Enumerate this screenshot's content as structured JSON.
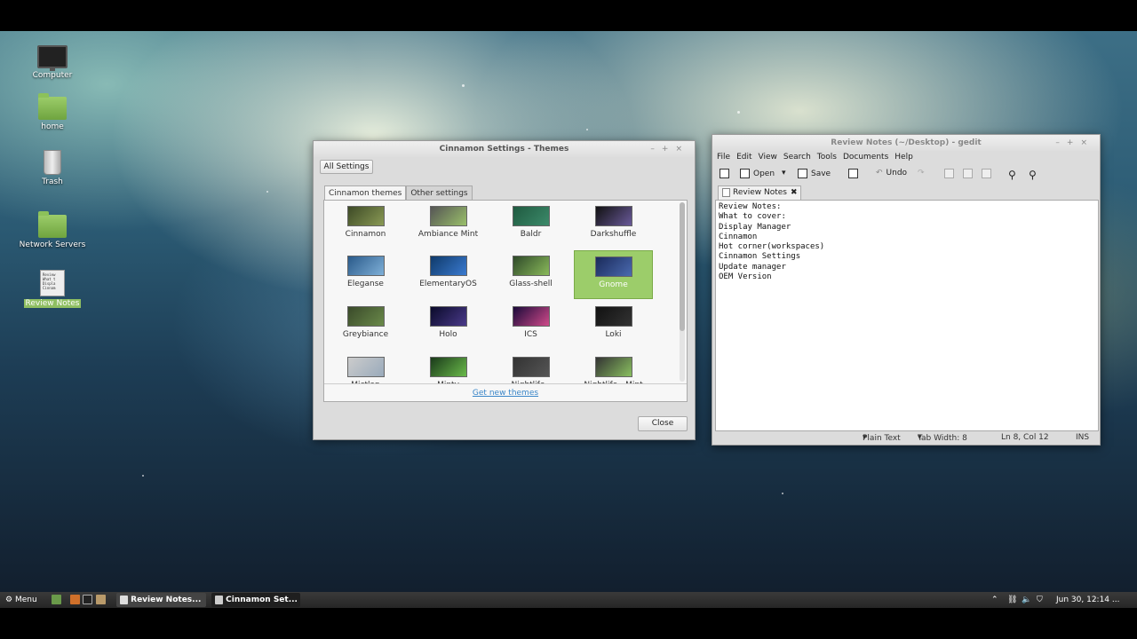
{
  "desktop": {
    "icons": [
      {
        "label": "Computer"
      },
      {
        "label": "home"
      },
      {
        "label": "Trash"
      },
      {
        "label": "Network Servers"
      },
      {
        "label": "Review Notes",
        "thumb_text": "Review What t Displa Cinnam"
      }
    ]
  },
  "themes_window": {
    "title": "Cinnamon Settings - Themes",
    "all_settings_label": "All Settings",
    "tabs": [
      "Cinnamon themes",
      "Other settings"
    ],
    "themes": [
      {
        "name": "Cinnamon",
        "colors": [
          "#3d4a26",
          "#8a9a55"
        ]
      },
      {
        "name": "Ambiance Mint",
        "colors": [
          "#555",
          "#9ac06a"
        ]
      },
      {
        "name": "Baldr",
        "colors": [
          "#1f5a40",
          "#3c8a6a"
        ]
      },
      {
        "name": "Darkshuffle",
        "colors": [
          "#111",
          "#6a5a9a"
        ]
      },
      {
        "name": "Eleganse",
        "colors": [
          "#2a5a8a",
          "#7fb0d8"
        ]
      },
      {
        "name": "ElementaryOS",
        "colors": [
          "#0f3a6a",
          "#3a7ad0"
        ]
      },
      {
        "name": "Glass-shell",
        "colors": [
          "#2f4a2a",
          "#8aba5a"
        ]
      },
      {
        "name": "Gnome",
        "colors": [
          "#1a2a5a",
          "#4a6ab0"
        ]
      },
      {
        "name": "Greybiance",
        "colors": [
          "#3a4a2a",
          "#6a8a4a"
        ]
      },
      {
        "name": "Holo",
        "colors": [
          "#0a0a2a",
          "#4a3a8a"
        ]
      },
      {
        "name": "ICS",
        "colors": [
          "#1a0a3a",
          "#d04a8a"
        ]
      },
      {
        "name": "Loki",
        "colors": [
          "#111",
          "#333"
        ]
      },
      {
        "name": "Mictlan",
        "colors": [
          "#ccc",
          "#9ab"
        ]
      },
      {
        "name": "Minty",
        "colors": [
          "#1a3a1a",
          "#6aba4a"
        ]
      },
      {
        "name": "Nightlife -",
        "colors": [
          "#333",
          "#555"
        ]
      },
      {
        "name": "Nightlife - Mint",
        "colors": [
          "#333",
          "#8ac060"
        ]
      }
    ],
    "selected_theme": "Gnome",
    "get_new_label": "Get new themes",
    "close_label": "Close"
  },
  "gedit": {
    "title": "Review Notes (~/Desktop) - gedit",
    "menu": [
      "File",
      "Edit",
      "View",
      "Search",
      "Tools",
      "Documents",
      "Help"
    ],
    "toolbar": {
      "open": "Open",
      "save": "Save",
      "undo": "Undo"
    },
    "tab_label": "Review Notes",
    "content": "Review Notes:\nWhat to cover:\nDisplay Manager\nCinnamon\nHot corner(workspaces)\nCinnamon Settings\nUpdate manager\nOEM Version",
    "status": {
      "mode": "Plain Text",
      "tab_width": "Tab Width:  8",
      "position": "Ln 8, Col 12",
      "ins": "INS"
    }
  },
  "panel": {
    "menu_label": "Menu",
    "tasks": [
      "Review Notes...",
      "Cinnamon Set..."
    ],
    "clock": "Jun 30, 12:14 ..."
  }
}
